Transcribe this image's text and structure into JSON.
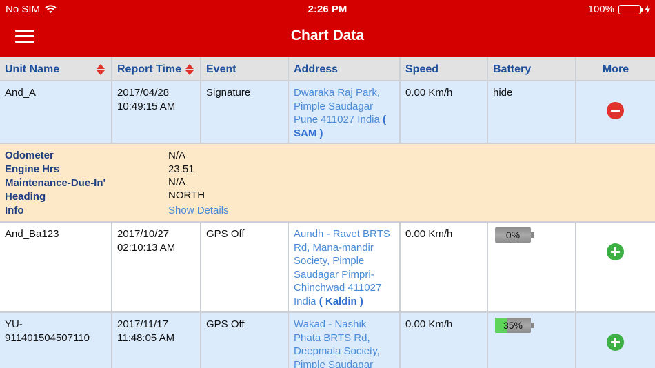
{
  "status": {
    "carrier": "No SIM",
    "time": "2:26 PM",
    "battery": "100%"
  },
  "nav": {
    "title": "Chart Data"
  },
  "columns": {
    "unit_name": "Unit Name",
    "report_time": "Report Time",
    "event": "Event",
    "address": "Address",
    "speed": "Speed",
    "battery": "Battery",
    "more": "More"
  },
  "rows": [
    {
      "unit": "And_A",
      "date": "2017/04/28",
      "time": "10:49:15 AM",
      "event": "Signature",
      "address": "Dwaraka Raj Park, Pimple Saudagar Pune 411027 India",
      "tag": "( SAM )",
      "speed": "0.00 Km/h",
      "battery": "hide"
    },
    {
      "unit": "And_Ba123",
      "date": "2017/10/27",
      "time": "02:10:13 AM",
      "event": "GPS Off",
      "address": "Aundh - Ravet BRTS Rd, Mana-mandir Society, Pimple Saudagar Pimpri-Chinchwad 411027 India",
      "tag": "( Kaldin )",
      "speed": "0.00 Km/h",
      "battery_label": "0%",
      "battery_level": 0
    },
    {
      "unit": "YU-911401504507110",
      "date": "2017/11/17",
      "time": "11:48:05 AM",
      "event": "GPS Off",
      "address": "Wakad - Nashik Phata BRTS Rd, Deepmala Society, Pimple Saudagar Pune",
      "speed": "0.00 Km/h",
      "battery_label": "35%",
      "battery_level": 0.35
    }
  ],
  "details": {
    "odometer_label": "Odometer",
    "odometer_value": "N/A",
    "engine_label": "Engine Hrs",
    "engine_value": "23.51",
    "maint_label": "Maintenance-Due-In'",
    "maint_value": "N/A",
    "heading_label": "Heading",
    "heading_value": "NORTH",
    "info_label": "Info",
    "info_value": "Show Details"
  },
  "colors": {
    "nav_bar": "#d40000",
    "header_text": "#1f4f9a",
    "link": "#4a8bd8",
    "detail_bg": "#fde9c8",
    "row_blue": "#dcebfb"
  },
  "icons": [
    "wifi-icon",
    "hamburger-menu-icon",
    "sort-icon",
    "collapse-minus-icon",
    "expand-plus-icon",
    "battery-icon"
  ]
}
